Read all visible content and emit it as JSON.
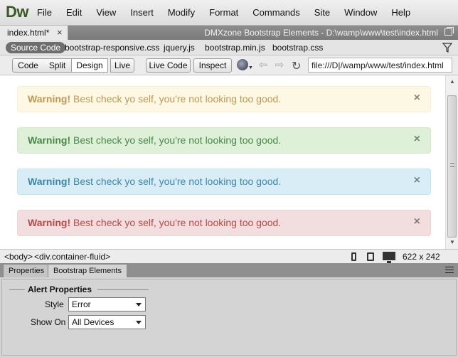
{
  "app": {
    "logo": "Dw",
    "menu": [
      "File",
      "Edit",
      "View",
      "Insert",
      "Modify",
      "Format",
      "Commands",
      "Site",
      "Window",
      "Help"
    ]
  },
  "document": {
    "tab_label": "index.html*",
    "tab_close": "×",
    "path": "DMXzone Bootstrap Elements - D:\\wamp\\www\\test\\index.html"
  },
  "related_files": {
    "source_code": "Source Code",
    "files": [
      "bootstrap-responsive.css",
      "jquery.js",
      "bootstrap.min.js",
      "bootstrap.css"
    ]
  },
  "toolbar": {
    "code": "Code",
    "split": "Split",
    "design": "Design",
    "live": "Live",
    "live_code": "Live Code",
    "inspect": "Inspect",
    "address": "file:///D|/wamp/www/test/index.html"
  },
  "alerts": [
    {
      "strong": "Warning!",
      "text": " Best check yo self, you're not looking too good.",
      "close": "×",
      "bg": "#fcf8e3",
      "border": "#fbeed5",
      "color": "#c09853"
    },
    {
      "strong": "Warning!",
      "text": " Best check yo self, you're not looking too good.",
      "close": "×",
      "bg": "#dff0d8",
      "border": "#d6e9c6",
      "color": "#468847"
    },
    {
      "strong": "Warning!",
      "text": " Best check yo self, you're not looking too good.",
      "close": "×",
      "bg": "#d9edf7",
      "border": "#bce8f1",
      "color": "#3a87ad"
    },
    {
      "strong": "Warning!",
      "text": " Best check yo self, you're not looking too good.",
      "close": "×",
      "bg": "#f2dede",
      "border": "#eed3d7",
      "color": "#b94a48"
    }
  ],
  "statusbar": {
    "tag_body": "<body>",
    "tag_div": "<div.container-fluid>",
    "size": "622 x 242"
  },
  "panel": {
    "tab_properties": "Properties",
    "tab_bootstrap": "Bootstrap Elements",
    "group_title": "Alert Properties",
    "style_label": "Style",
    "style_value": "Error",
    "showon_label": "Show On",
    "showon_value": "All Devices"
  }
}
